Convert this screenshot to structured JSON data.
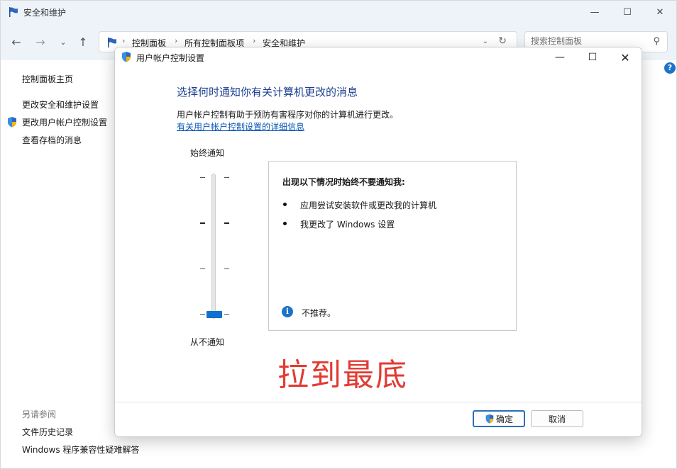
{
  "background_window": {
    "title": "安全和维护",
    "breadcrumbs": [
      "控制面板",
      "所有控制面板项",
      "安全和维护"
    ],
    "search_placeholder": "搜索控制面板",
    "sidebar": {
      "items": [
        {
          "label": "控制面板主页"
        },
        {
          "label": "更改安全和维护设置"
        },
        {
          "label": "更改用户帐户控制设置"
        },
        {
          "label": "查看存档的消息"
        }
      ],
      "see_also_label": "另请参阅",
      "see_also_items": [
        {
          "label": "文件历史记录"
        },
        {
          "label": "Windows 程序兼容性疑难解答"
        }
      ]
    }
  },
  "dialog": {
    "title": "用户帐户控制设置",
    "heading": "选择何时通知你有关计算机更改的消息",
    "description": "用户帐户控制有助于预防有害程序对你的计算机进行更改。",
    "link": "有关用户帐户控制设置的详细信息",
    "slider": {
      "label_top": "始终通知",
      "label_bottom": "从不通知",
      "levels": 4,
      "selected_level": 0
    },
    "panel": {
      "heading": "出现以下情况时始终不要通知我:",
      "bullets": [
        "应用尝试安装软件或更改我的计算机",
        "我更改了 Windows 设置"
      ],
      "note": "不推荐。"
    },
    "annotation": "拉到最底",
    "buttons": {
      "ok": "确定",
      "cancel": "取消"
    }
  },
  "colors": {
    "heading_blue": "#1a3d8f",
    "link_blue": "#0b56b3",
    "thumb_blue": "#1170cf",
    "annotation_red": "#e23b32"
  },
  "icons": {
    "window": "flag-icon",
    "uac": "uac-shield-icon",
    "info": "info-icon",
    "help": "help-icon"
  }
}
